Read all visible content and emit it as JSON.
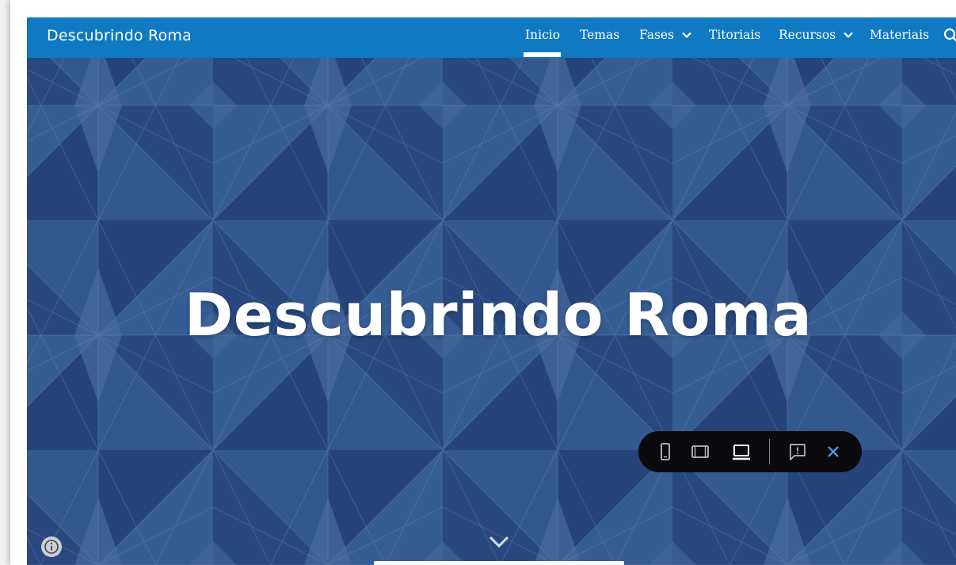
{
  "site": {
    "title": "Descubrindo Roma"
  },
  "nav": {
    "items": [
      {
        "label": "Inicio",
        "has_dropdown": false,
        "active": true
      },
      {
        "label": "Temas",
        "has_dropdown": false
      },
      {
        "label": "Fases",
        "has_dropdown": true
      },
      {
        "label": "Titoriais",
        "has_dropdown": false
      },
      {
        "label": "Recursos",
        "has_dropdown": true
      },
      {
        "label": "Materiais",
        "has_dropdown": false
      }
    ],
    "search_icon": "search-icon"
  },
  "hero": {
    "title": "Descubrindo Roma"
  },
  "preview_bar": {
    "buttons": [
      "phone-icon",
      "tablet-icon",
      "laptop-icon",
      "report-issue-icon",
      "close-icon"
    ],
    "selected": "laptop-icon"
  },
  "colors": {
    "navbar": "#0f79c3",
    "hero_bg": "#2d4f86",
    "preview_bar": "#0b0b0f",
    "close_accent": "#4aa3f0"
  }
}
